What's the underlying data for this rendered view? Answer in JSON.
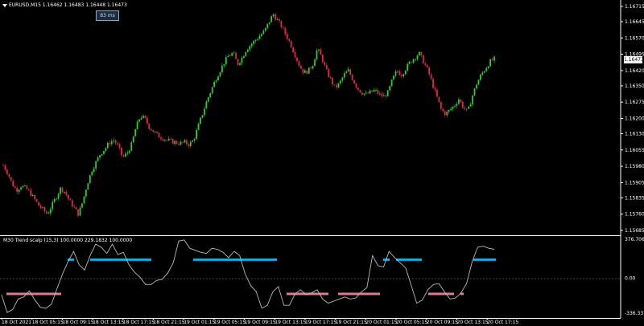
{
  "header": {
    "symbol_line": "EURUSD,M15  1.16462  1.16483  1.16448  1.16473",
    "badge": "83 ms"
  },
  "main_chart": {
    "current_price_label": "1.16473",
    "price_ticks": [
      "1.16715",
      "1.16645",
      "1.16570",
      "1.16495",
      "1.16420",
      "1.16350",
      "1.16275",
      "1.16200",
      "1.16130",
      "1.16055",
      "1.15980",
      "1.15905",
      "1.15835",
      "1.15760",
      "1.15685"
    ],
    "price_range": [
      1.15685,
      1.16715
    ]
  },
  "indicator": {
    "title": "M30 Trend scalp (15,3) 100.0000 229.1832 100.0000",
    "ticks": [
      "376.7068",
      "0.00",
      "-336.3372"
    ]
  },
  "time_axis": {
    "labels": [
      "18 Oct 2021",
      "18 Oct 05:15",
      "18 Oct 09:15",
      "18 Oct 13:15",
      "18 Oct 17:15",
      "18 Oct 21:15",
      "19 Oct 01:15",
      "19 Oct 05:15",
      "19 Oct 09:15",
      "19 Oct 13:15",
      "19 Oct 17:15",
      "19 Oct 21:15",
      "20 Oct 01:15",
      "20 Oct 05:15",
      "20 Oct 09:15",
      "20 Oct 13:15",
      "20 Oct 17:15"
    ]
  },
  "colors": {
    "bull": "#2ecc2e",
    "bear": "#e0284a",
    "band_up": "#1ea8e0",
    "band_down": "#e07a8c",
    "oscillator": "#b8b8b8",
    "axis": "#ffffff",
    "background": "#000000"
  },
  "chart_data": {
    "type": "candlestick",
    "close_path": [
      1.15985,
      1.1595,
      1.159,
      1.1587,
      1.1589,
      1.1588,
      1.1586,
      1.1583,
      1.158,
      1.1578,
      1.1576,
      1.158,
      1.1584,
      1.1588,
      1.1586,
      1.1582,
      1.1579,
      1.1576,
      1.1582,
      1.159,
      1.1596,
      1.16,
      1.1604,
      1.1606,
      1.1609,
      1.161,
      1.1607,
      1.1602,
      1.1604,
      1.1608,
      1.1616,
      1.1621,
      1.162,
      1.1616,
      1.1614,
      1.1612,
      1.1611,
      1.161,
      1.16095,
      1.1609,
      1.16085,
      1.1609,
      1.1608,
      1.161,
      1.1616,
      1.1622,
      1.1628,
      1.1633,
      1.1638,
      1.1642,
      1.1646,
      1.1649,
      1.165,
      1.1645,
      1.1648,
      1.1652,
      1.1654,
      1.1656,
      1.1658,
      1.166,
      1.1664,
      1.1668,
      1.1665,
      1.1662,
      1.1658,
      1.1654,
      1.1649,
      1.1644,
      1.1641,
      1.1642,
      1.1645,
      1.1652,
      1.1648,
      1.1642,
      1.1638,
      1.1634,
      1.1636,
      1.164,
      1.1642,
      1.1638,
      1.1634,
      1.1632,
      1.1631,
      1.1632,
      1.1633,
      1.1631,
      1.163,
      1.1632,
      1.1638,
      1.1642,
      1.164,
      1.1643,
      1.1646,
      1.1648,
      1.165,
      1.1646,
      1.1642,
      1.1636,
      1.163,
      1.1624,
      1.1622,
      1.1624,
      1.1626,
      1.1629,
      1.1625,
      1.1623,
      1.163,
      1.1636,
      1.164,
      1.1643,
      1.1646,
      1.16473
    ],
    "oscillator_path": [
      -160,
      -330,
      -300,
      -200,
      -180,
      -120,
      -210,
      -280,
      -290,
      -250,
      -100,
      40,
      160,
      260,
      130,
      80,
      220,
      330,
      300,
      240,
      330,
      230,
      250,
      130,
      60,
      10,
      -60,
      -60,
      -20,
      -10,
      50,
      150,
      360,
      370,
      290,
      270,
      250,
      240,
      290,
      280,
      250,
      200,
      260,
      220,
      40,
      -70,
      -130,
      -290,
      -260,
      -130,
      -80,
      -260,
      -260,
      -150,
      -110,
      -160,
      -140,
      -110,
      -200,
      -240,
      -220,
      -200,
      -180,
      -200,
      -190,
      -130,
      -90,
      220,
      120,
      110,
      260,
      200,
      150,
      100,
      -70,
      -240,
      -210,
      -110,
      -60,
      -50,
      -130,
      -200,
      -190,
      -140,
      -50,
      160,
      300,
      310,
      290,
      280
    ],
    "bands": [
      {
        "dir": "down",
        "from": 0.01,
        "to": 0.095
      },
      {
        "dir": "up",
        "from": 0.105,
        "to": 0.115
      },
      {
        "dir": "up",
        "from": 0.14,
        "to": 0.235
      },
      {
        "dir": "up",
        "from": 0.3,
        "to": 0.43
      },
      {
        "dir": "down",
        "from": 0.445,
        "to": 0.51
      },
      {
        "dir": "down",
        "from": 0.525,
        "to": 0.59
      },
      {
        "dir": "up",
        "from": 0.595,
        "to": 0.605
      },
      {
        "dir": "up",
        "from": 0.615,
        "to": 0.655
      },
      {
        "dir": "down",
        "from": 0.665,
        "to": 0.705
      },
      {
        "dir": "down",
        "from": 0.715,
        "to": 0.72
      },
      {
        "dir": "up",
        "from": 0.735,
        "to": 0.77
      }
    ]
  }
}
